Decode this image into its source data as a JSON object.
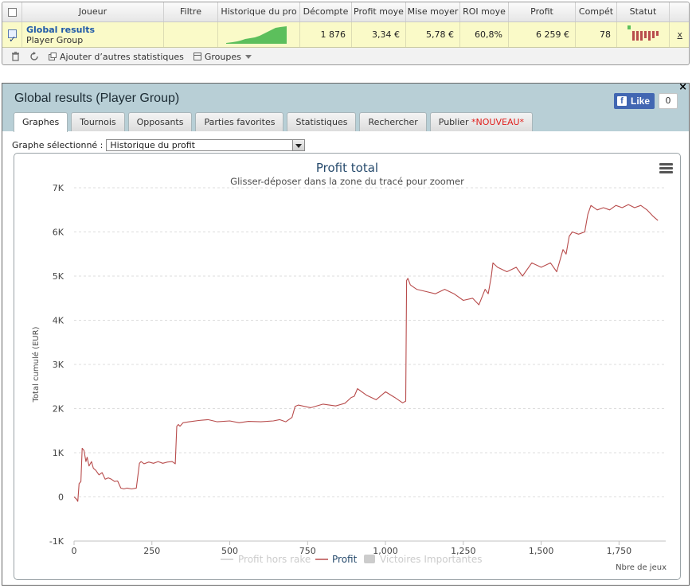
{
  "table": {
    "columns": [
      "Joueur",
      "Filtre",
      "Historique du pro",
      "Décompte",
      "Profit moye",
      "Mise moyer",
      "ROI moye",
      "Profit",
      "Compét",
      "Statut"
    ],
    "row": {
      "player_name": "Global results",
      "player_group": "Player Group",
      "filter": "",
      "count": "1 876",
      "avg_profit": "3,34 €",
      "avg_stake": "5,78 €",
      "roi": "60,8%",
      "profit": "6 259 €",
      "competitions": "78",
      "remove": "x"
    }
  },
  "toolbar": {
    "add_stats_label": "Ajouter d’autres statistiques",
    "groups_label": "Groupes"
  },
  "panel": {
    "title": "Global results (Player Group)",
    "close": "×",
    "fb_like": "Like",
    "fb_count": "0",
    "tabs": [
      {
        "label": "Graphes"
      },
      {
        "label": "Tournois"
      },
      {
        "label": "Opposants"
      },
      {
        "label": "Parties favorites"
      },
      {
        "label": "Statistiques"
      },
      {
        "label": "Rechercher"
      },
      {
        "label": "Publier",
        "badge": "*NOUVEAU*"
      }
    ],
    "graph_select_label": "Graphe sélectionné :",
    "graph_select_value": "Historique du profit"
  },
  "colors": {
    "profit_line": "#b84c4c",
    "legend_inactive": "#cccccc",
    "header_bg": "#b8cfd6",
    "sparkline": "#5cbf5c",
    "row_highlight": "#fafac8"
  },
  "chart_data": {
    "type": "line",
    "title": "Profit total",
    "subtitle": "Glisser-déposer dans la zone du tracé pour zoomer",
    "xlabel": "Nbre de jeux",
    "ylabel": "Total cumulé (EUR)",
    "xlim": [
      0,
      1900
    ],
    "ylim": [
      -1000,
      7000
    ],
    "x_ticks": [
      0,
      250,
      500,
      750,
      1000,
      1250,
      1500,
      1750
    ],
    "x_tick_labels": [
      "0",
      "250",
      "500",
      "750",
      "1,000",
      "1,250",
      "1,500",
      "1,750"
    ],
    "y_ticks": [
      -1000,
      0,
      1000,
      2000,
      3000,
      4000,
      5000,
      6000,
      7000
    ],
    "y_tick_labels": [
      "-1K",
      "0",
      "1K",
      "2K",
      "3K",
      "4K",
      "5K",
      "6K",
      "7K"
    ],
    "grid": "horizontal dashed",
    "legend": {
      "placement": "bottom",
      "items": [
        {
          "name": "Profit hors rake",
          "active": false
        },
        {
          "name": "Profit",
          "active": true
        },
        {
          "name": "Victoires Importantes",
          "active": false
        }
      ]
    },
    "series": [
      {
        "name": "Profit",
        "x": [
          0,
          8,
          12,
          16,
          22,
          26,
          32,
          38,
          42,
          48,
          56,
          62,
          70,
          80,
          90,
          100,
          110,
          120,
          130,
          140,
          150,
          160,
          170,
          185,
          200,
          210,
          215,
          225,
          240,
          255,
          270,
          285,
          300,
          315,
          325,
          330,
          335,
          340,
          350,
          370,
          400,
          430,
          460,
          500,
          530,
          560,
          600,
          640,
          660,
          680,
          700,
          710,
          720,
          760,
          800,
          840,
          870,
          890,
          900,
          910,
          940,
          970,
          1000,
          1030,
          1055,
          1065,
          1068,
          1072,
          1080,
          1100,
          1130,
          1160,
          1190,
          1220,
          1250,
          1280,
          1300,
          1320,
          1330,
          1340,
          1345,
          1360,
          1390,
          1420,
          1440,
          1470,
          1500,
          1530,
          1550,
          1570,
          1580,
          1590,
          1600,
          1620,
          1640,
          1650,
          1660,
          1680,
          1700,
          1720,
          1740,
          1760,
          1780,
          1800,
          1820,
          1840,
          1860,
          1875
        ],
        "values": [
          0,
          -50,
          -100,
          300,
          350,
          1100,
          1050,
          800,
          900,
          700,
          800,
          650,
          600,
          500,
          550,
          400,
          430,
          400,
          350,
          360,
          200,
          180,
          200,
          180,
          200,
          760,
          800,
          750,
          790,
          760,
          800,
          760,
          790,
          800,
          750,
          1600,
          1640,
          1600,
          1680,
          1700,
          1730,
          1750,
          1700,
          1720,
          1680,
          1710,
          1700,
          1720,
          1750,
          1700,
          1800,
          2050,
          2080,
          2020,
          2100,
          2060,
          2120,
          2250,
          2280,
          2450,
          2300,
          2200,
          2380,
          2250,
          2130,
          2170,
          4900,
          4950,
          4800,
          4700,
          4650,
          4600,
          4700,
          4600,
          4450,
          4500,
          4350,
          4700,
          4600,
          5000,
          5300,
          5200,
          5100,
          5200,
          5000,
          5300,
          5200,
          5300,
          5100,
          5600,
          5500,
          5900,
          6000,
          5950,
          6000,
          6400,
          6600,
          6500,
          6550,
          6500,
          6600,
          6550,
          6620,
          6550,
          6600,
          6500,
          6350,
          6260
        ]
      }
    ]
  }
}
